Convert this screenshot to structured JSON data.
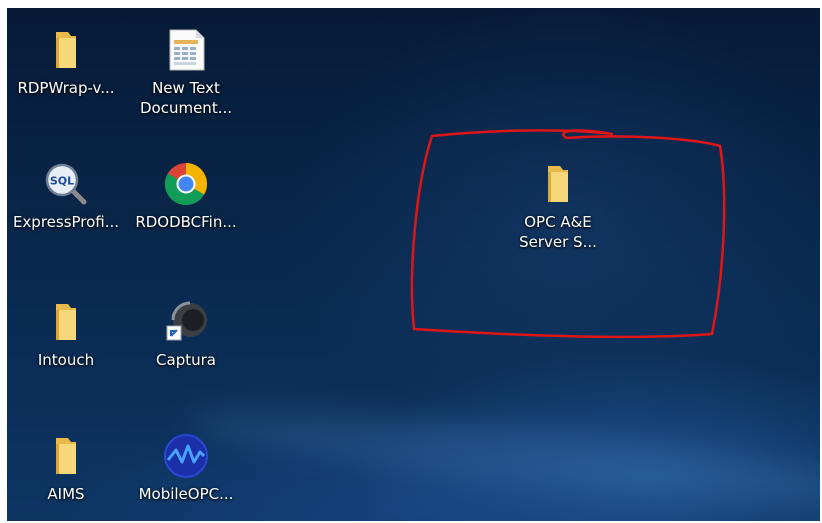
{
  "desktop": {
    "icons": [
      {
        "label": "RDPWrap-v...",
        "icon": "folder-icon"
      },
      {
        "label": "New Text\nDocument...",
        "icon": "text-document-icon"
      },
      {
        "label": "ExpressProfi...",
        "icon": "sql-profiler-icon"
      },
      {
        "label": "RDODBCFin...",
        "icon": "chrome-icon"
      },
      {
        "label": "Intouch",
        "icon": "folder-icon"
      },
      {
        "label": "Captura",
        "icon": "captura-shortcut-icon"
      },
      {
        "label": "AIMS",
        "icon": "folder-icon"
      },
      {
        "label": "MobileOPC...",
        "icon": "mobileopc-icon"
      },
      {
        "label": "OPC A&E\nServer S...",
        "icon": "folder-icon"
      }
    ],
    "annotation_color": "#e01515",
    "folder_color": "#f2d06b"
  }
}
